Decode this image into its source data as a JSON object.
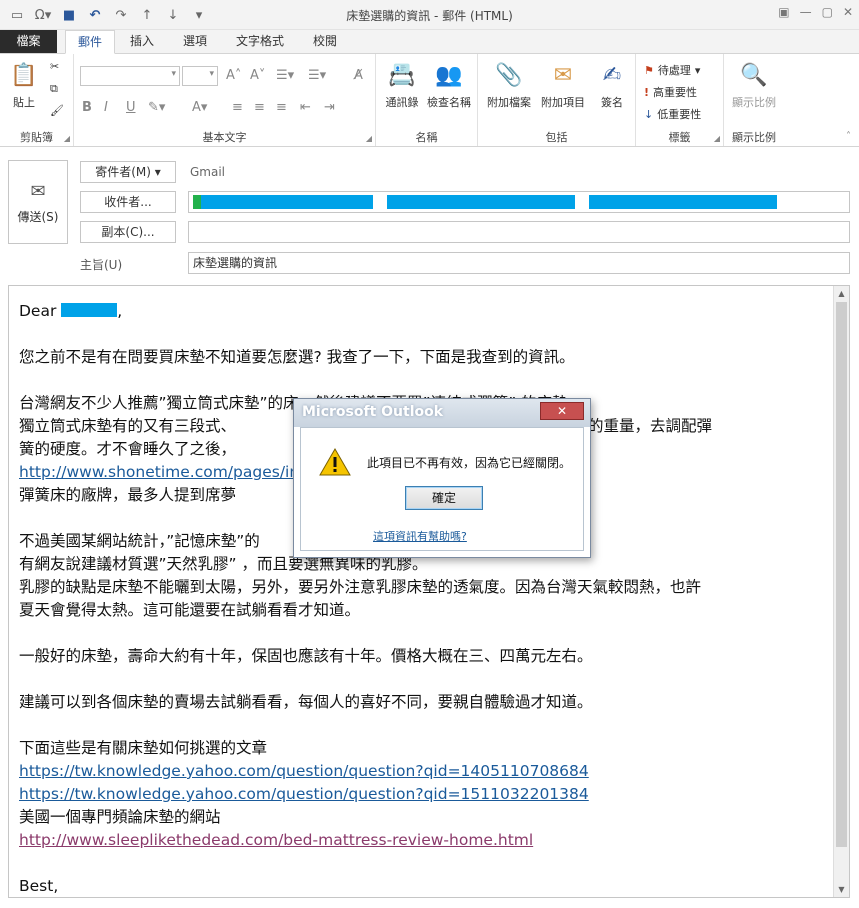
{
  "window": {
    "title": "床墊選購的資訊 - 郵件 (HTML)"
  },
  "tabs": [
    {
      "label": "檔案"
    },
    {
      "label": "郵件"
    },
    {
      "label": "插入"
    },
    {
      "label": "選項"
    },
    {
      "label": "文字格式"
    },
    {
      "label": "校閱"
    }
  ],
  "ribbon": {
    "clipboard": {
      "paste": "貼上",
      "label": "剪貼簿"
    },
    "basic_text": {
      "label": "基本文字"
    },
    "names": {
      "address_book": "通訊錄",
      "check_names": "檢查名稱",
      "label": "名稱"
    },
    "include": {
      "attach_file": "附加檔案",
      "attach_item": "附加項目",
      "signature": "簽名",
      "label": "包括"
    },
    "tags": {
      "follow_up": "待處理",
      "high_importance": "高重要性",
      "low_importance": "低重要性",
      "label": "標籤"
    },
    "zoom": {
      "zoom": "顯示比例",
      "label": "顯示比例"
    }
  },
  "header": {
    "send": "傳送(S)",
    "from_button": "寄件者(M) ▾",
    "from_value": "Gmail",
    "to_button": "收件者...",
    "cc_button": "副本(C)...",
    "subject_label": "主旨(U)",
    "subject_value": "床墊選購的資訊"
  },
  "body": {
    "greeting": "Dear",
    "p1": "您之前不是有在問要買床墊不知道要怎麼選? 我查了一下，下面是我查到的資訊。",
    "p2a": "台灣網友不少人推薦”獨立筒式床墊”的床，然後建議不要買”連結式彈簧” 的床墊。",
    "p2b": "獨立筒式床墊有的又有三段式、",
    "p2b_end": "身體不同的重量，去調配彈",
    "p2c": "簧的硬度。才不會睡久了之後，",
    "p2d_link": "http://www.shonetime.com/pages/in",
    "p2e": "彈簧床的廠牌，最多人提到席夢",
    "p3a": "不過美國某網站統計，”記憶床墊”的",
    "p3b": "有網友說建議材質選”天然乳膠” ，而且要選無異味的乳膠。",
    "p3c": "乳膠的缺點是床墊不能曬到太陽，另外，要另外注意乳膠床墊的透氣度。因為台灣天氣較悶熱，也許",
    "p3d": "夏天會覺得太熱。這可能還要在試躺看看才知道。",
    "p4": "一般好的床墊，壽命大約有十年，保固也應該有十年。價格大概在三、四萬元左右。",
    "p5": "建議可以到各個床墊的賣場去試躺看看，每個人的喜好不同，要親自體驗過才知道。",
    "p6": "下面這些是有關床墊如何挑選的文章",
    "link1": "https://tw.knowledge.yahoo.com/question/question?qid=1405110708684",
    "link2": "https://tw.knowledge.yahoo.com/question/question?qid=1511032201384",
    "p7": "美國一個專門頻論床墊的網站",
    "link3": "http://www.sleeplikethedead.com/bed-mattress-review-home.html",
    "closing": "Best,"
  },
  "dialog": {
    "title": "Microsoft Outlook",
    "message": "此項目已不再有效，因為它已經關閉。",
    "ok": "確定",
    "help": "這項資訊有幫助嗎?"
  },
  "colors": {
    "accent": "#2b579a",
    "redaction": "#00a2e8",
    "link": "#1a5a9a",
    "visited_link": "#8b3a6b"
  }
}
